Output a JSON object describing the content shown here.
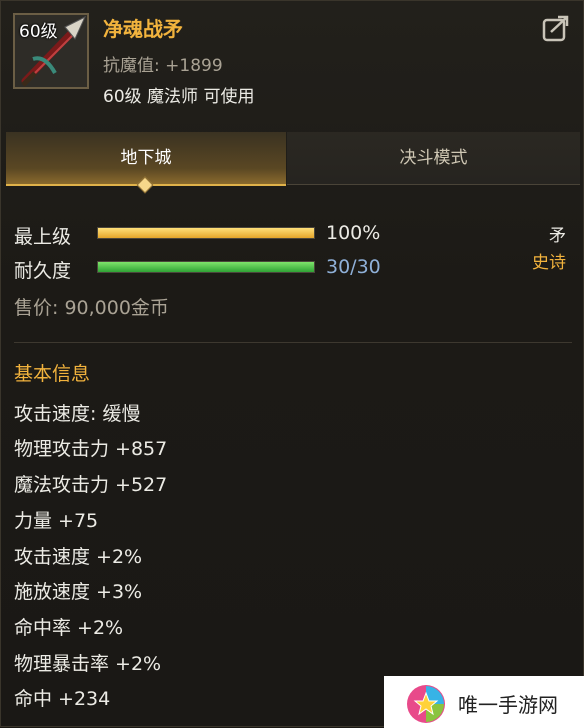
{
  "item": {
    "level_badge": "60级",
    "name": "净魂战矛",
    "stat_line": "抗魔值: +1899",
    "requirement": "60级 魔法师 可使用"
  },
  "tabs": [
    {
      "label": "地下城",
      "active": true
    },
    {
      "label": "决斗模式",
      "active": false
    }
  ],
  "grade": {
    "label": "最上级",
    "value_text": "100%",
    "fill_fraction": 1.0
  },
  "durability": {
    "label": "耐久度",
    "value_text": "30/30",
    "fill_fraction": 1.0
  },
  "weapon_type": "矛",
  "rarity": "史诗",
  "price": "售价: 90,000金币",
  "basic_info_title": "基本信息",
  "attributes": [
    "攻击速度: 缓慢",
    "物理攻击力 +857",
    "魔法攻击力 +527",
    "力量 +75",
    "攻击速度 +2%",
    "施放速度 +3%",
    "命中率 +2%",
    "物理暴击率 +2%",
    "命中 +234"
  ],
  "watermark": {
    "text": "唯一手游网"
  },
  "colors": {
    "name": "#f2b33d",
    "rarity": "#f2b33d",
    "durability_value": "#8fb0d8",
    "grade_bar": "#f0c040",
    "durability_bar": "#3fbf3f"
  }
}
